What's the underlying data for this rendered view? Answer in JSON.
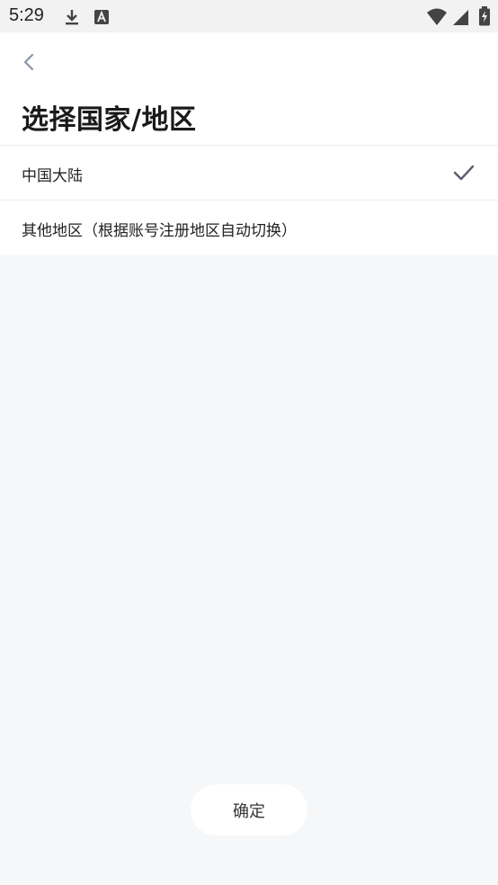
{
  "status_bar": {
    "time": "5:29"
  },
  "header": {
    "title": "选择国家/地区"
  },
  "regions": [
    {
      "label": "中国大陆",
      "selected": true
    },
    {
      "label": "其他地区（根据账号注册地区自动切换）",
      "selected": false
    }
  ],
  "footer": {
    "confirm_label": "确定"
  },
  "colors": {
    "background": "#f6f7f9",
    "surface": "#ffffff",
    "check": "#5a5f6b",
    "back_arrow": "#8a94a6"
  }
}
